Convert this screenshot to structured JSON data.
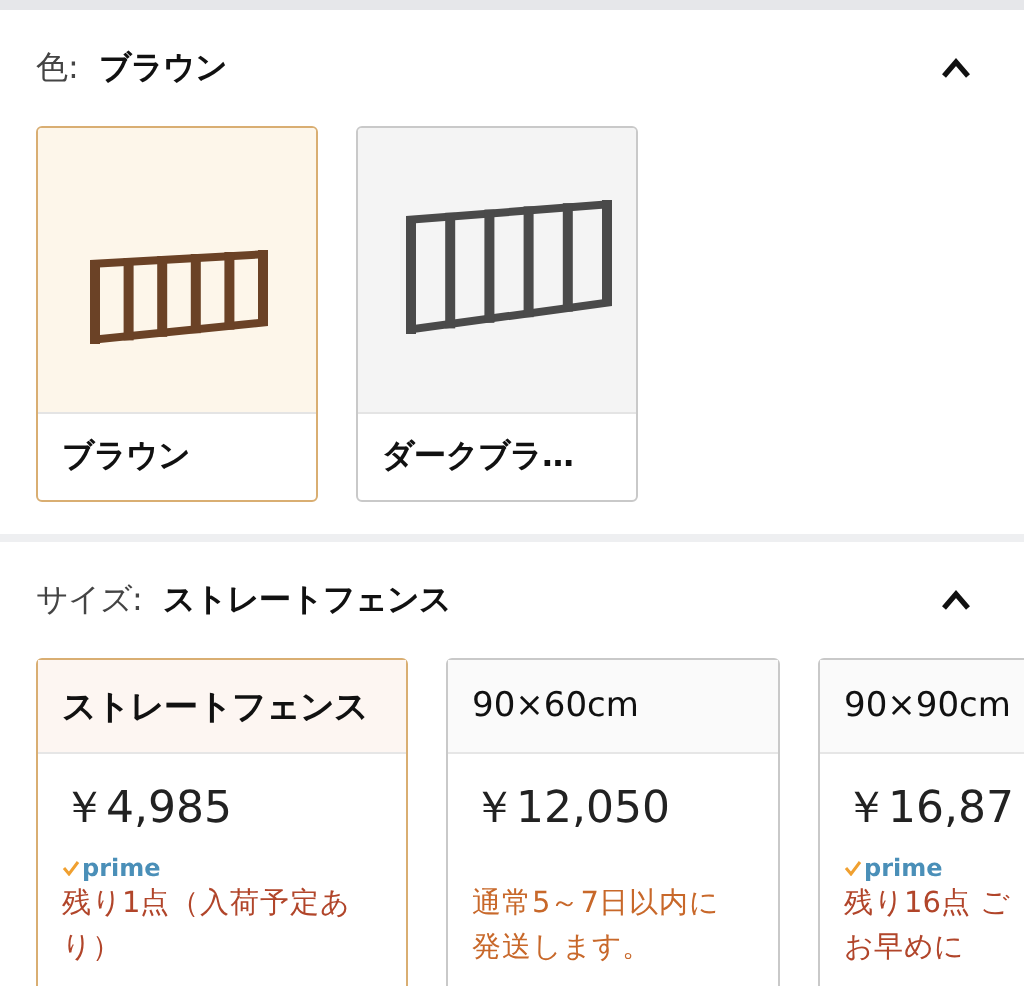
{
  "color_section": {
    "label": "色:",
    "value": "ブラウン",
    "expanded": true,
    "options": [
      {
        "label": "ブラウン",
        "selected": true,
        "kind": "brown"
      },
      {
        "label": "ダークブラ…",
        "selected": false,
        "kind": "dark"
      }
    ]
  },
  "size_section": {
    "label": "サイズ:",
    "value": "ストレートフェンス",
    "expanded": true,
    "options": [
      {
        "label": "ストレートフェンス",
        "selected": true,
        "price": "￥4,985",
        "prime": true,
        "prime_text": "prime",
        "kind": "stock",
        "availability": [
          "残り1点（入荷予定あ",
          "り）"
        ]
      },
      {
        "label": "90×60cm",
        "selected": false,
        "price": "￥12,050",
        "prime": false,
        "kind": "shipping",
        "availability": [
          "通常5～7日以内に",
          "発送します。"
        ]
      },
      {
        "label": "90×90cm",
        "selected": false,
        "price": "￥16,87",
        "prime": true,
        "prime_text": "prime",
        "kind": "stock",
        "availability": [
          "残り16点 ご",
          "お早めに"
        ]
      }
    ]
  }
}
